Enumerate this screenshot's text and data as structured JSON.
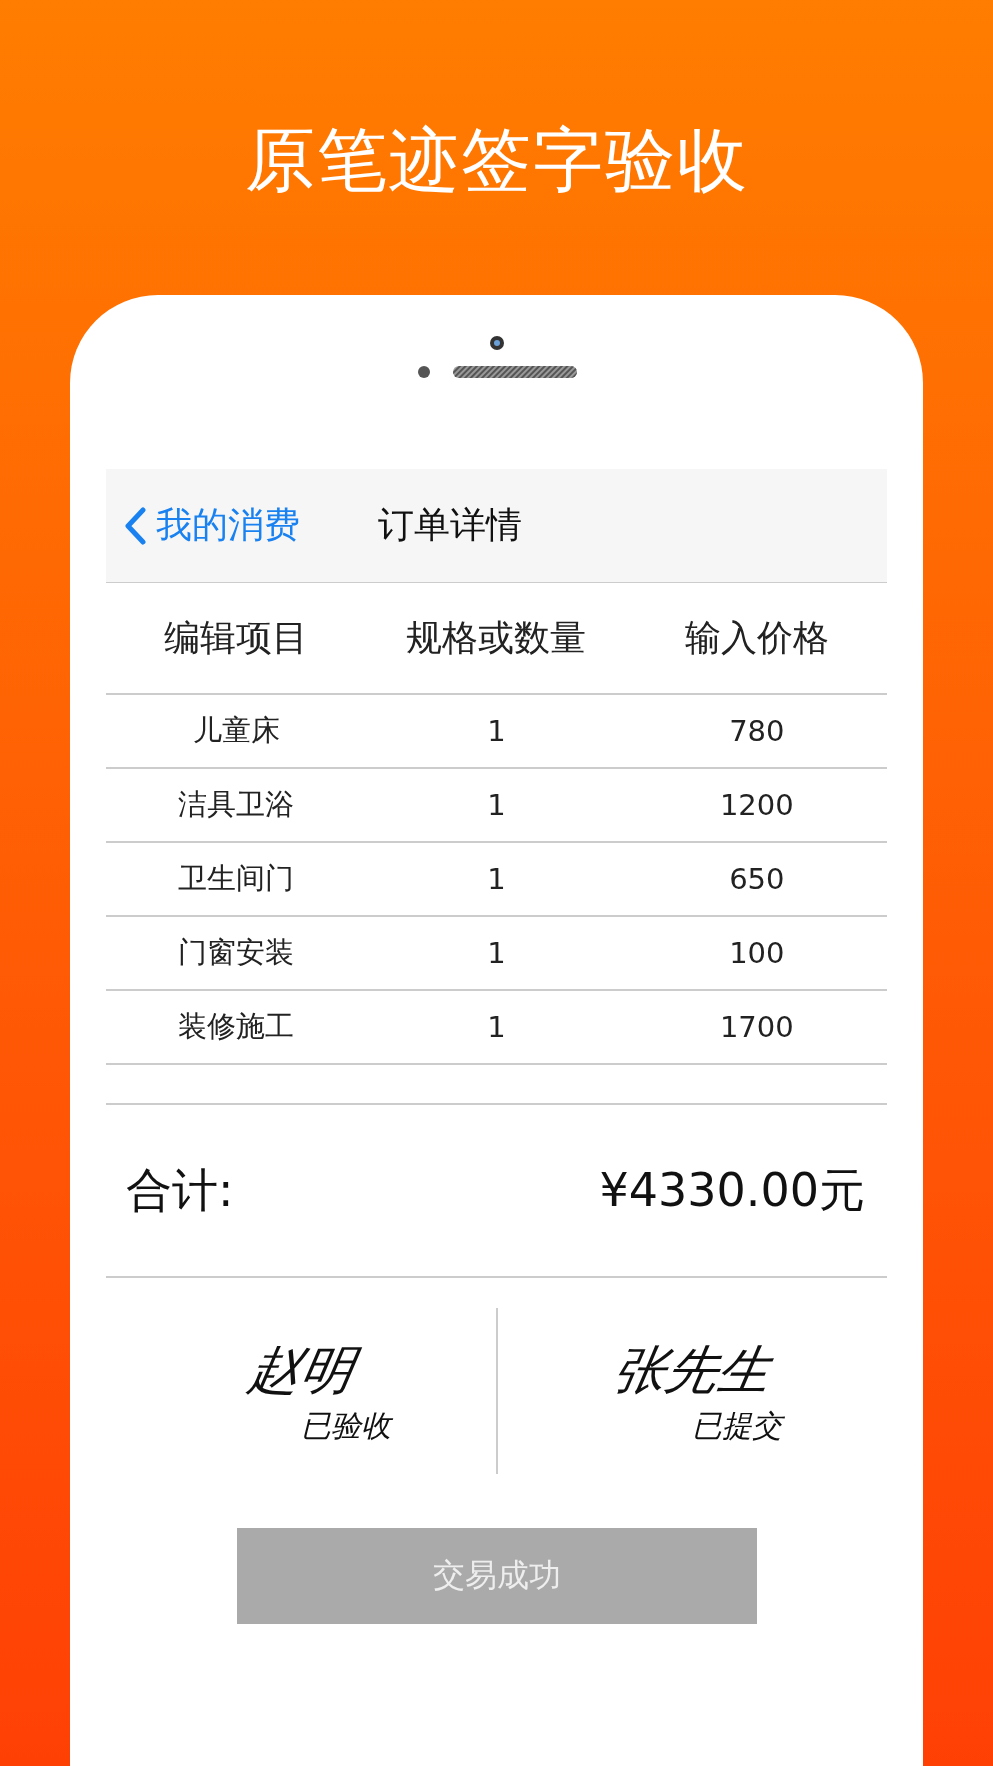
{
  "headline": "原笔迹签字验收",
  "nav": {
    "back": "我的消费",
    "title": "订单详情"
  },
  "table": {
    "columns": [
      "编辑项目",
      "规格或数量",
      "输入价格"
    ],
    "rows": [
      [
        "儿童床",
        "1",
        "780"
      ],
      [
        "洁具卫浴",
        "1",
        "1200"
      ],
      [
        "卫生间门",
        "1",
        "650"
      ],
      [
        "门窗安装",
        "1",
        "100"
      ],
      [
        "装修施工",
        "1",
        "1700"
      ]
    ]
  },
  "total": {
    "label": "合计:",
    "amount": "¥4330.00元"
  },
  "signatures": [
    {
      "name": "赵明",
      "status": "已验收"
    },
    {
      "name": "张先生",
      "status": "已提交"
    }
  ],
  "button": {
    "label": "交易成功",
    "disabled": true
  }
}
